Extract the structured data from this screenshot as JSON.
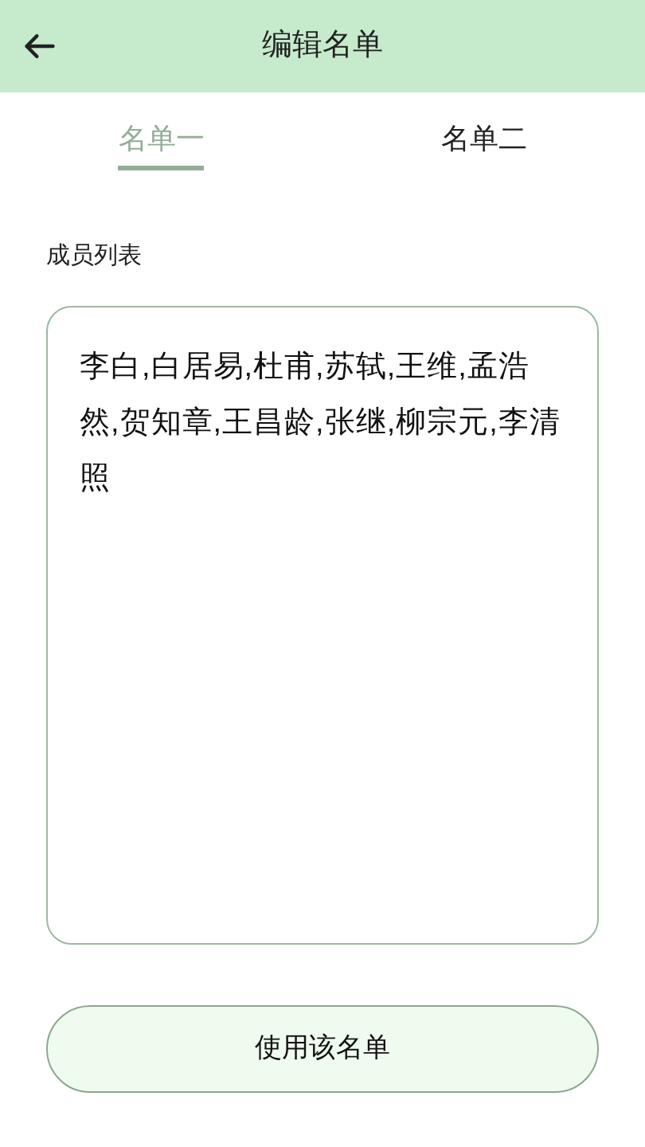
{
  "header": {
    "title": "编辑名单"
  },
  "tabs": [
    {
      "label": "名单一",
      "selected": true
    },
    {
      "label": "名单二",
      "selected": false
    }
  ],
  "members": {
    "label": "成员列表",
    "value": "李白,白居易,杜甫,苏轼,王维,孟浩然,贺知章,王昌龄,张继,柳宗元,李清照"
  },
  "button": {
    "label": "使用该名单"
  }
}
